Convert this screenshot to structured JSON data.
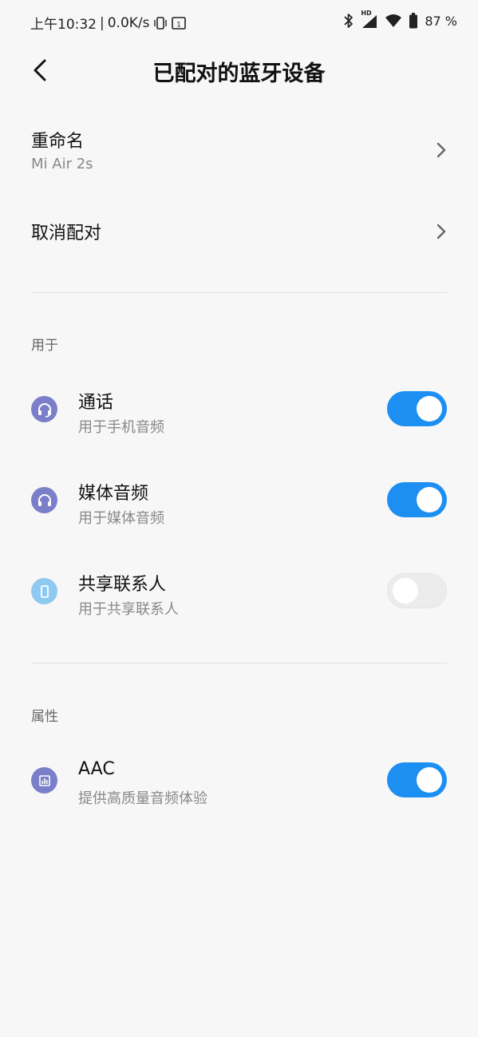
{
  "status_bar": {
    "time": "上午10:32",
    "separator": "|",
    "speed": "0.0K/s",
    "hd_label": "HD",
    "battery": "87 %",
    "calendar_day": "1"
  },
  "header": {
    "title": "已配对的蓝牙设备"
  },
  "rename": {
    "label": "重命名",
    "value": "Mi Air 2s"
  },
  "unpair": {
    "label": "取消配对"
  },
  "sections": {
    "usage": "用于",
    "properties": "属性"
  },
  "usage_items": [
    {
      "title": "通话",
      "subtitle": "用于手机音频",
      "enabled": true,
      "icon": "headset-icon",
      "icon_color": "#7b7fc9"
    },
    {
      "title": "媒体音频",
      "subtitle": "用于媒体音频",
      "enabled": true,
      "icon": "headphones-icon",
      "icon_color": "#7b7fc9"
    },
    {
      "title": "共享联系人",
      "subtitle": "用于共享联系人",
      "enabled": false,
      "icon": "phone-icon",
      "icon_color": "#8ec9f2"
    }
  ],
  "property_items": [
    {
      "title": "AAC",
      "subtitle": "提供高质量音频体验",
      "enabled": true,
      "icon": "audio-bars-icon",
      "icon_color": "#7b7fc9"
    }
  ],
  "colors": {
    "toggle_on": "#1d8ff2",
    "toggle_off": "#ececec",
    "background": "#f7f7f7"
  }
}
